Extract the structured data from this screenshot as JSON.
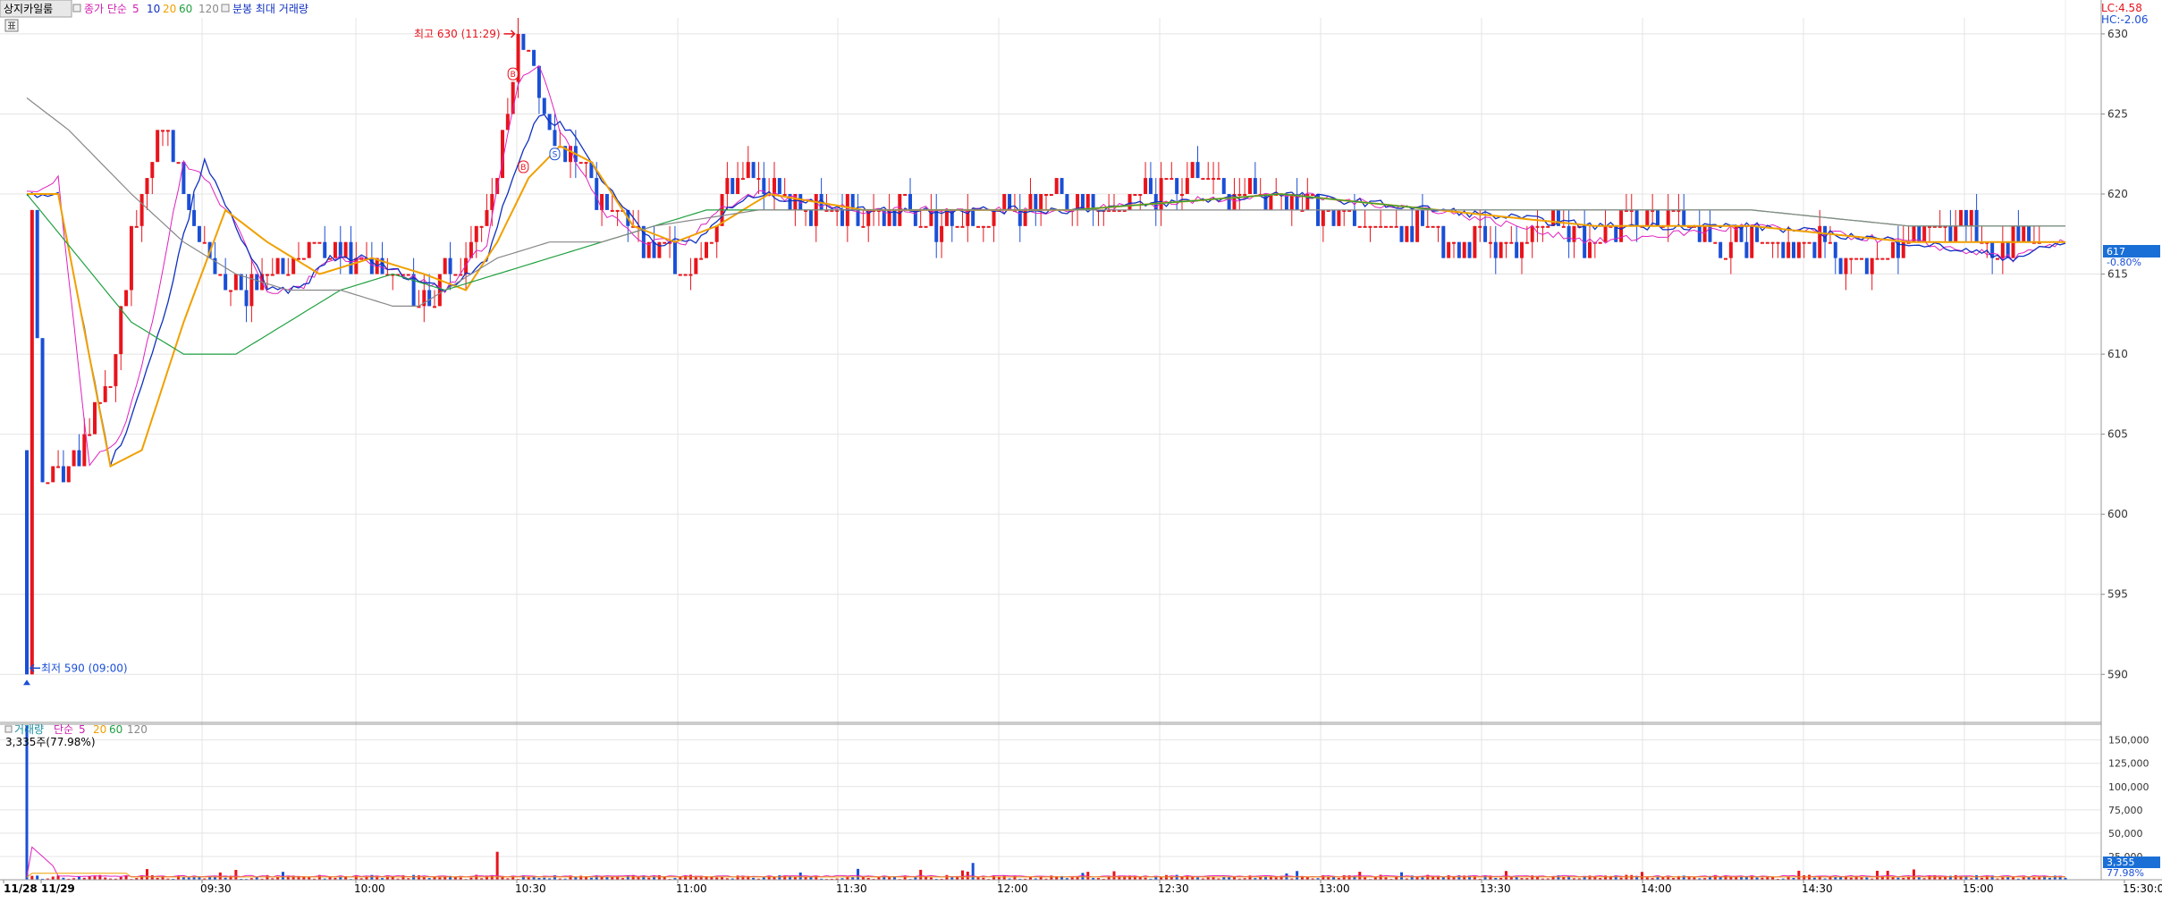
{
  "header": {
    "title": "상지카일룸",
    "ma_label": "종가 단순",
    "ma_periods": [
      "5",
      "10",
      "20",
      "60",
      "120"
    ],
    "volume_label": "분봉 최대 거래량"
  },
  "right_info": {
    "lc": "LC:4.58",
    "hc": "HC:-2.06",
    "current_price": "617",
    "current_change": "-0.80%",
    "current_volume": "3,355",
    "volume_ratio": "77.98%"
  },
  "annotations": {
    "high": "최고 630 (11:29)",
    "low": "최저 590 (09:00)",
    "marker_b1": "B",
    "marker_b2": "B",
    "marker_s": "S"
  },
  "volume_panel": {
    "title": "거래량",
    "ma_label": "단순",
    "ma_periods": [
      "5",
      "20",
      "60",
      "120"
    ],
    "value": "3,335주(77.98%)"
  },
  "colors": {
    "up": "#e8141c",
    "down": "#1a4fd6",
    "ma5": "#e020c0",
    "ma10": "#1030c0",
    "ma20": "#f0a000",
    "ma60": "#20a040",
    "ma120": "#888888",
    "grid": "#e4e4e4"
  },
  "chart_data": {
    "type": "candlestick",
    "x_ticks": [
      "11/28",
      "11/29",
      "09:30",
      "10:00",
      "10:30",
      "11:00",
      "11:30",
      "12:00",
      "12:30",
      "13:00",
      "13:30",
      "14:00",
      "14:30",
      "15:00",
      "15:30:00"
    ],
    "price_axis": {
      "ylim": [
        587,
        631
      ],
      "ticks": [
        630,
        625,
        620,
        615,
        610,
        605,
        600,
        595,
        590
      ]
    },
    "volume_axis": {
      "ylim": [
        0,
        165000
      ],
      "ticks": [
        "150,000",
        "125,000",
        "100,000",
        "75,000",
        "50,000",
        "25,000"
      ]
    },
    "price_anchors": {
      "t": [
        0,
        0.3,
        0.6,
        1,
        3,
        5,
        6.5,
        8,
        9,
        10,
        11,
        12,
        14,
        15,
        16,
        18,
        20,
        22,
        24,
        26,
        28,
        30,
        32,
        34,
        36,
        38,
        40,
        42,
        44,
        46,
        48,
        50,
        52,
        54,
        56,
        58,
        60,
        62,
        64,
        66,
        68,
        70,
        72,
        74,
        76,
        78,
        80,
        82,
        84,
        86,
        88,
        90,
        92,
        94,
        96,
        98,
        100,
        103,
        106,
        109,
        112,
        115,
        118,
        121,
        124,
        127,
        130,
        133,
        136,
        139,
        142,
        145,
        148,
        151,
        154,
        157,
        160,
        163,
        166,
        169,
        172,
        175,
        178,
        181,
        184,
        187,
        190,
        193,
        196,
        199,
        202,
        205,
        208,
        211,
        214,
        217,
        220,
        223,
        226,
        229,
        232,
        235,
        238,
        241,
        244,
        247,
        250,
        253,
        256,
        259,
        262,
        265,
        268,
        271,
        274,
        277,
        280,
        283,
        286,
        289,
        292,
        295,
        298,
        301,
        304,
        307,
        310,
        313,
        316,
        319,
        322,
        325,
        328,
        331,
        334,
        337,
        340,
        343,
        346,
        349,
        352,
        355,
        358,
        361,
        364,
        367,
        370,
        373,
        376,
        379,
        382,
        385,
        388,
        391
      ],
      "p": [
        618,
        621,
        620,
        619,
        602,
        602,
        602,
        603,
        604,
        604,
        605,
        605,
        607,
        608,
        608,
        613,
        617,
        620,
        622,
        624,
        623,
        620,
        618,
        616,
        615,
        614,
        614,
        614,
        614,
        615,
        616,
        616,
        616,
        616,
        616,
        616,
        616,
        616,
        616,
        616,
        616,
        615,
        615,
        614,
        614,
        614,
        615,
        615,
        616,
        617,
        619,
        621,
        625,
        628,
        629,
        626,
        624,
        623,
        622,
        620,
        619,
        618,
        617,
        617,
        616,
        616,
        617,
        620,
        621,
        621,
        620,
        620,
        619,
        619,
        619,
        619,
        619,
        619,
        619,
        619,
        618,
        618,
        618,
        618,
        619,
        619,
        619,
        619,
        620,
        620,
        620,
        619,
        619,
        620,
        620,
        620,
        620,
        621,
        621,
        620,
        620,
        620,
        620,
        620,
        619,
        619,
        619,
        619,
        618,
        618,
        618,
        618,
        618,
        617,
        617,
        617,
        617,
        617,
        617,
        618,
        618,
        618,
        617,
        618,
        618,
        619,
        618,
        618,
        618,
        618,
        617,
        617,
        617,
        617,
        617,
        617,
        617,
        617,
        616,
        616,
        616,
        616,
        617,
        617,
        617,
        618,
        618,
        618,
        617,
        617,
        617,
        617
      ]
    },
    "ma_series": [
      {
        "name": "5",
        "t": [
          0,
          6,
          12,
          18,
          20,
          24,
          30,
          34,
          40,
          46,
          52,
          58,
          64,
          72,
          80,
          88,
          94,
          98,
          102,
          110,
          118,
          126,
          132,
          140,
          160,
          200,
          240,
          270,
          300,
          330,
          360,
          380,
          390
        ],
        "p": [
          620,
          621,
          603,
          605,
          607,
          612,
          622,
          621,
          618,
          614,
          614,
          616,
          616,
          615,
          614,
          617,
          627,
          628,
          624,
          619,
          617,
          617,
          619,
          620,
          619,
          619,
          620,
          619,
          617,
          618,
          617,
          616,
          617
        ]
      },
      {
        "name": "10",
        "t": [
          0,
          6,
          16,
          20,
          26,
          32,
          34,
          40,
          46,
          52,
          58,
          64,
          72,
          80,
          88,
          94,
          98,
          104,
          112,
          120,
          128,
          134,
          140,
          160,
          200,
          240,
          270,
          300,
          330,
          360,
          380,
          390
        ],
        "p": [
          620,
          620,
          603,
          606,
          612,
          620,
          622,
          618,
          614,
          614,
          616,
          616,
          615,
          614,
          616,
          622,
          625,
          624,
          620,
          617,
          617,
          619,
          620,
          619,
          619,
          620,
          619,
          618,
          618,
          617,
          616,
          617
        ]
      },
      {
        "name": "20",
        "t": [
          0,
          6,
          16,
          22,
          30,
          38,
          46,
          56,
          66,
          76,
          84,
          90,
          96,
          102,
          108,
          116,
          124,
          132,
          142,
          160,
          200,
          240,
          270,
          300,
          330,
          360,
          380,
          390
        ],
        "p": [
          620,
          620,
          603,
          604,
          612,
          619,
          617,
          615,
          616,
          615,
          614,
          617,
          621,
          623,
          622,
          618,
          617,
          618,
          620,
          619,
          619,
          620,
          619,
          618,
          618,
          617,
          617,
          617
        ]
      },
      {
        "name": "60",
        "t": [
          0,
          10,
          20,
          30,
          40,
          50,
          60,
          70,
          80,
          90,
          100,
          110,
          120,
          130,
          140,
          160,
          200,
          240,
          270,
          300,
          330,
          360,
          380,
          390
        ],
        "p": [
          620,
          616,
          612,
          610,
          610,
          612,
          614,
          615,
          614,
          615,
          616,
          617,
          618,
          619,
          619,
          619,
          619,
          620,
          619,
          619,
          619,
          618,
          618,
          618
        ]
      },
      {
        "name": "120",
        "t": [
          0,
          8,
          20,
          30,
          40,
          50,
          60,
          70,
          75,
          80,
          90,
          100,
          110,
          120,
          140,
          160,
          200,
          240,
          270,
          300,
          330,
          360,
          380,
          390
        ],
        "p": [
          626,
          624,
          620,
          617,
          615,
          614,
          614,
          613,
          613,
          614,
          616,
          617,
          617,
          618,
          619,
          619,
          619,
          619,
          619,
          619,
          619,
          618,
          618,
          618
        ]
      }
    ],
    "high": {
      "t": 94,
      "price": 630
    },
    "low": {
      "t": 0,
      "price": 590
    },
    "volume": {
      "spike_t": 0,
      "spike_value": 165000,
      "second_t": 90,
      "second_value": 30000,
      "third_t": 181,
      "third_value": 18000
    }
  }
}
